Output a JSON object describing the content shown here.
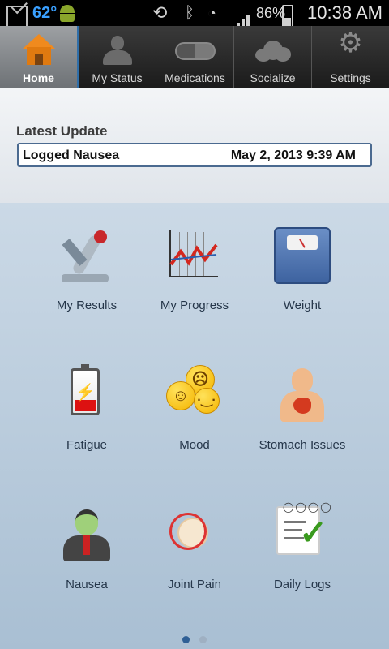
{
  "status_bar": {
    "temperature": "62°",
    "battery_percent": "86%",
    "time": "10:38 AM"
  },
  "tabs": [
    {
      "label": "Home",
      "icon": "home-icon",
      "active": true
    },
    {
      "label": "My Status",
      "icon": "person-icon",
      "active": false
    },
    {
      "label": "Medications",
      "icon": "pill-icon",
      "active": false
    },
    {
      "label": "Socialize",
      "icon": "cloud-icon",
      "active": false
    },
    {
      "label": "Settings",
      "icon": "gears-icon",
      "active": false
    }
  ],
  "latest_update": {
    "title": "Latest Update",
    "text": "Logged Nausea",
    "timestamp": "May 2, 2013 9:39 AM"
  },
  "tiles": [
    {
      "label": "My Results",
      "icon": "microscope-icon"
    },
    {
      "label": "My Progress",
      "icon": "chart-icon"
    },
    {
      "label": "Weight",
      "icon": "scale-icon"
    },
    {
      "label": "Fatigue",
      "icon": "battery-icon"
    },
    {
      "label": "Mood",
      "icon": "smiley-faces-icon"
    },
    {
      "label": "Stomach Issues",
      "icon": "stomach-icon"
    },
    {
      "label": "Nausea",
      "icon": "sick-person-icon"
    },
    {
      "label": "Joint Pain",
      "icon": "joint-icon"
    },
    {
      "label": "Daily Logs",
      "icon": "clipboard-check-icon"
    }
  ],
  "pager": {
    "pages": 2,
    "current": 1
  },
  "colors": {
    "tab_active": "#8a8d90",
    "accent_blue": "#4b6a90",
    "home_orange": "#f08a1e"
  }
}
